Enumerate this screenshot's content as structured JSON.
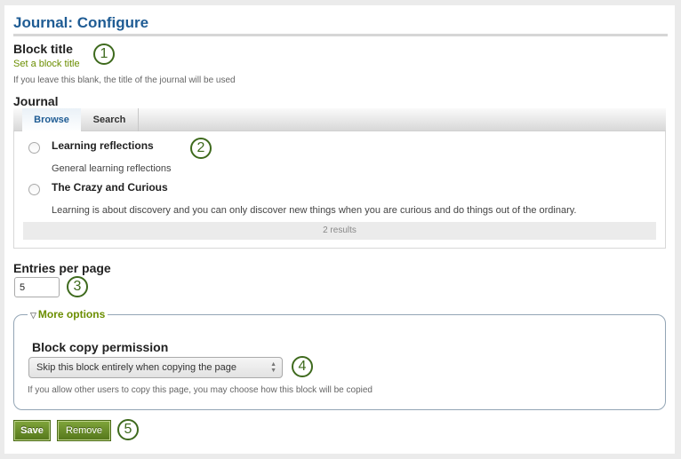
{
  "header": {
    "title": "Journal: Configure",
    "close_icon": "close-icon"
  },
  "block_title": {
    "label": "Block title",
    "link": "Set a block title",
    "description": "If you leave this blank, the title of the journal will be used",
    "callout": "1"
  },
  "journal": {
    "label": "Journal",
    "tabs": [
      {
        "label": "Browse",
        "active": true
      },
      {
        "label": "Search",
        "active": false
      }
    ],
    "items": [
      {
        "title": "Learning reflections",
        "description": "General learning reflections",
        "selected": false
      },
      {
        "title": "The Crazy and Curious",
        "description": "Learning is about discovery and you can only discover new things when you are curious and do things out of the ordinary.",
        "selected": false
      }
    ],
    "results": "2 results",
    "callout": "2"
  },
  "entries_per_page": {
    "label": "Entries per page",
    "value": "5",
    "callout": "3"
  },
  "more_options": {
    "legend": "More options",
    "copy_permission": {
      "label": "Block copy permission",
      "selected": "Skip this block entirely when copying the page",
      "description": "If you allow other users to copy this page, you may choose how this block will be copied",
      "callout": "4"
    }
  },
  "actions": {
    "save_label": "Save",
    "remove_label": "Remove",
    "callout": "5"
  },
  "colors": {
    "title": "#1f5c94",
    "link": "#6b8e00",
    "callout": "#3e6a1d",
    "button": "#6a8f2a"
  }
}
